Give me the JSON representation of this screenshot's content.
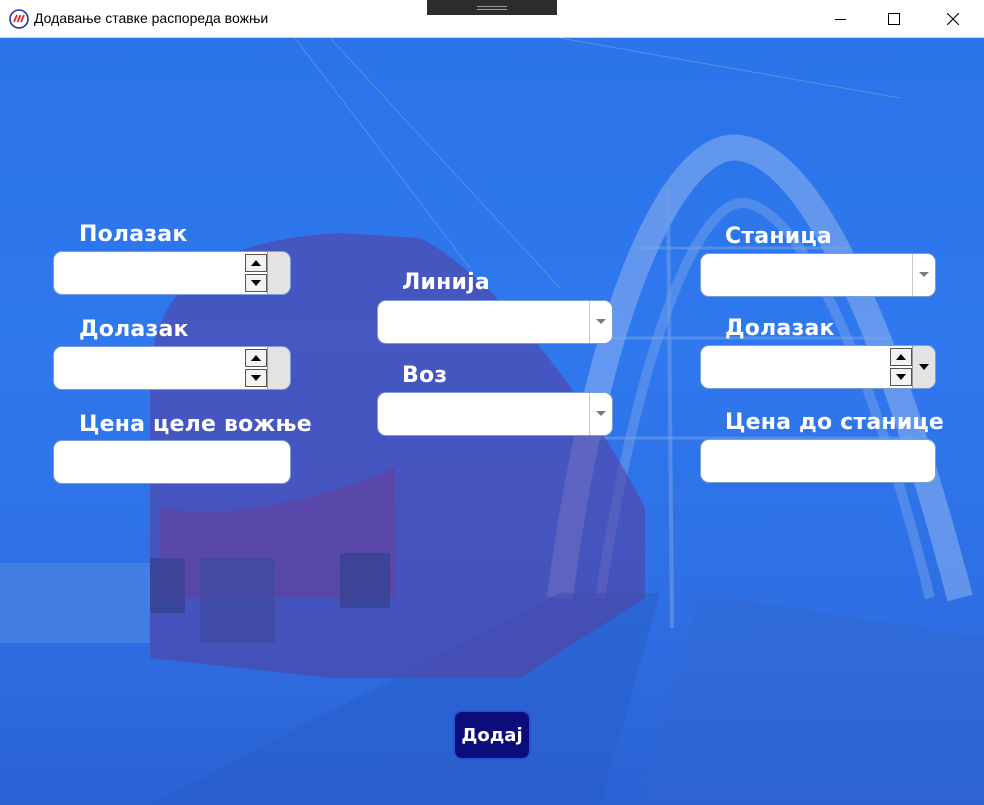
{
  "window": {
    "title": "Додавање ставке распореда вожњи",
    "icon": "serbian-railways-logo-icon",
    "controls": [
      "minimize-icon",
      "maximize-icon",
      "close-icon"
    ]
  },
  "form": {
    "departure_label": "Полазак",
    "arrival_label": "Долазак",
    "full_price_label": "Цена целе вожње",
    "line_label": "Линија",
    "train_label": "Воз",
    "station_label": "Станица",
    "station_arrival_label": "Долазак",
    "station_price_label": "Цена до станице",
    "departure_value": "",
    "arrival_value": "",
    "full_price_value": "",
    "line_value": "",
    "train_value": "",
    "station_value": "",
    "station_arrival_value": "",
    "station_price_value": ""
  },
  "actions": {
    "add_label": "Додај"
  },
  "colors": {
    "background_overlay": "#2f78ee",
    "button_fill": "#0a0d7a",
    "label_text": "#ffffff"
  }
}
